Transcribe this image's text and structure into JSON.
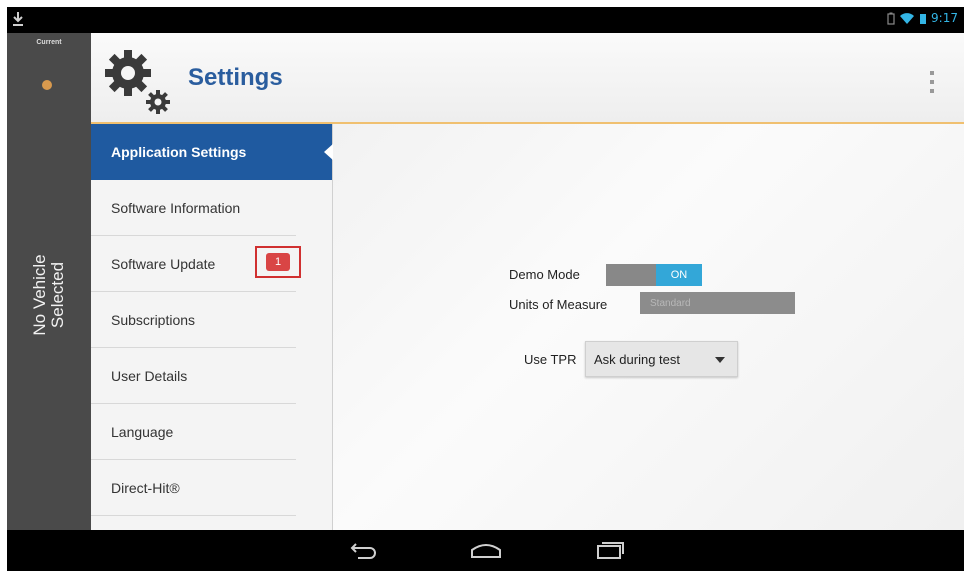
{
  "status_bar": {
    "time": "9:17",
    "icons": [
      "download-icon",
      "battery-icon",
      "wifi-icon",
      "signal-icon"
    ]
  },
  "left_rail": {
    "current_label": "Current",
    "vehicle_line1": "No Vehicle",
    "vehicle_line2": "Selected"
  },
  "header": {
    "title": "Settings",
    "icon": "gear-icon",
    "menu_icon": "overflow-menu-icon"
  },
  "nav": {
    "items": [
      {
        "label": "Application Settings",
        "active": true
      },
      {
        "label": "Software Information",
        "active": false
      },
      {
        "label": "Software Update",
        "active": false,
        "badge": "1"
      },
      {
        "label": "Subscriptions",
        "active": false
      },
      {
        "label": "User Details",
        "active": false
      },
      {
        "label": "Language",
        "active": false
      },
      {
        "label": "Direct-Hit®",
        "active": false
      }
    ]
  },
  "settings": {
    "demo_mode_label": "Demo Mode",
    "demo_mode_value": "ON",
    "units_label": "Units of Measure",
    "units_value": "Standard",
    "tpr_label": "Use TPR",
    "tpr_value": "Ask during test"
  },
  "colors": {
    "accent": "#1f5aa0",
    "toggle_on": "#33a7d8",
    "badge": "#d94545",
    "header_rule": "#f0c070"
  },
  "nav_bar": {
    "buttons": [
      "back-icon",
      "home-icon",
      "recent-apps-icon"
    ]
  }
}
